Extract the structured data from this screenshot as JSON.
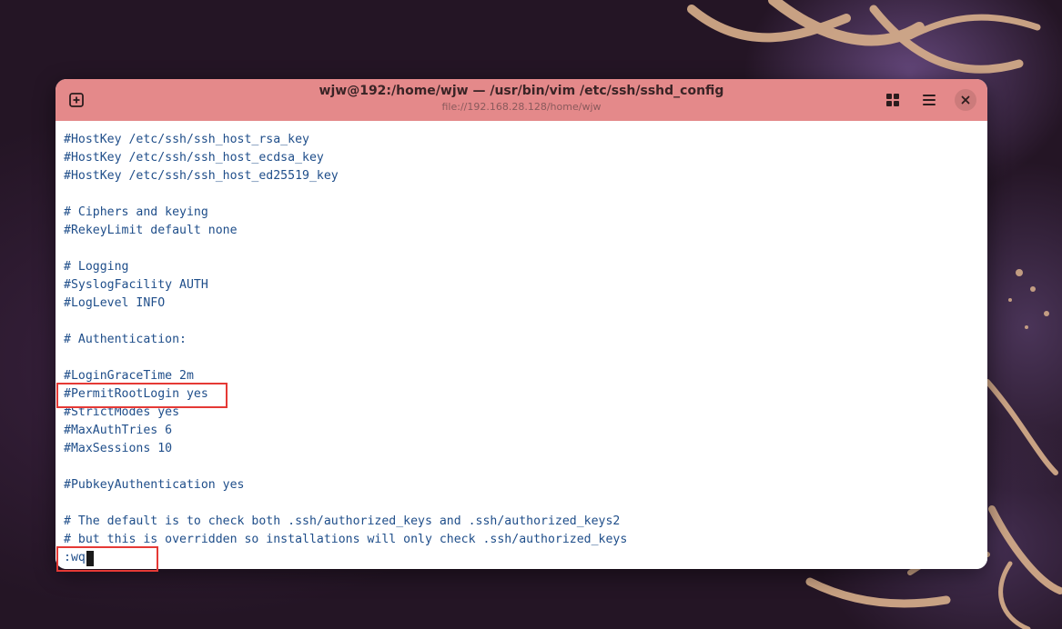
{
  "window": {
    "title": "wjw@192:/home/wjw — /usr/bin/vim /etc/ssh/sshd_config",
    "subtitle": "file://192.168.28.128/home/wjw"
  },
  "titlebar": {
    "new_tab_icon": "new-tab-icon",
    "grid_icon": "overview-grid-icon",
    "menu_icon": "hamburger-menu-icon",
    "close_icon": "close-icon"
  },
  "editor": {
    "lines": [
      "#HostKey /etc/ssh/ssh_host_rsa_key",
      "#HostKey /etc/ssh/ssh_host_ecdsa_key",
      "#HostKey /etc/ssh/ssh_host_ed25519_key",
      "",
      "# Ciphers and keying",
      "#RekeyLimit default none",
      "",
      "# Logging",
      "#SyslogFacility AUTH",
      "#LogLevel INFO",
      "",
      "# Authentication:",
      "",
      "#LoginGraceTime 2m",
      "#PermitRootLogin yes",
      "#StrictModes yes",
      "#MaxAuthTries 6",
      "#MaxSessions 10",
      "",
      "#PubkeyAuthentication yes",
      "",
      "# The default is to check both .ssh/authorized_keys and .ssh/authorized_keys2",
      "# but this is overridden so installations will only check .ssh/authorized_keys"
    ],
    "command": ":wq"
  },
  "colors": {
    "titlebar": "#e4898a",
    "text": "#1f4e8a",
    "highlight_box": "#e53935"
  }
}
